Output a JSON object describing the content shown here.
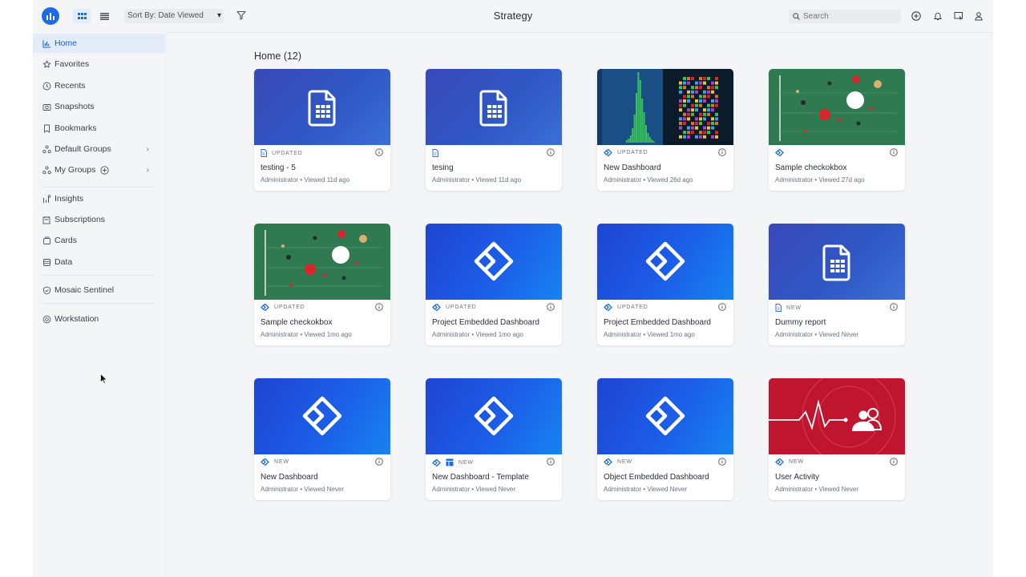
{
  "app": {
    "title": "Strategy"
  },
  "toolbar": {
    "sort_label": "Sort By: Date Viewed",
    "search_placeholder": "Search"
  },
  "sidebar": {
    "items": [
      {
        "label": "Home",
        "icon": "chart-icon",
        "active": true
      },
      {
        "label": "Favorites",
        "icon": "star-icon"
      },
      {
        "label": "Recents",
        "icon": "clock-icon"
      },
      {
        "label": "Snapshots",
        "icon": "camera-icon"
      },
      {
        "label": "Bookmarks",
        "icon": "bookmark-icon"
      },
      {
        "label": "Default Groups",
        "icon": "groups-icon"
      },
      {
        "label": "My Groups",
        "icon": "groups-icon"
      },
      {
        "label": "Insights",
        "icon": "insights-icon"
      },
      {
        "label": "Subscriptions",
        "icon": "subscriptions-icon"
      },
      {
        "label": "Cards",
        "icon": "cards-icon"
      },
      {
        "label": "Data",
        "icon": "database-icon"
      },
      {
        "label": "Mosaic Sentinel",
        "icon": "shield-icon"
      },
      {
        "label": "Workstation",
        "icon": "workstation-icon"
      }
    ]
  },
  "main": {
    "section_title": "Home (12)",
    "cards": [
      {
        "title": "testing - 5",
        "badge": "UPDATED",
        "sub": "Administrator • Viewed 11d ago",
        "type": "document",
        "thumb": "doc"
      },
      {
        "title": "tesing",
        "badge": "",
        "sub": "Administrator • Viewed 11d ago",
        "type": "document",
        "thumb": "doc"
      },
      {
        "title": "New Dashboard",
        "badge": "UPDATED",
        "sub": "Administrator • Viewed 26d ago",
        "type": "dashboard",
        "thumb": "chart"
      },
      {
        "title": "Sample checkokbox",
        "badge": "",
        "sub": "Administrator • Viewed 27d ago",
        "type": "dashboard",
        "thumb": "green"
      },
      {
        "title": "Sample checkokbox",
        "badge": "UPDATED",
        "sub": "Administrator • Viewed 1mo ago",
        "type": "dashboard",
        "thumb": "green"
      },
      {
        "title": "Project Embedded Dashboard",
        "badge": "UPDATED",
        "sub": "Administrator • Viewed 1mo ago",
        "type": "dashboard",
        "thumb": "dash"
      },
      {
        "title": "Project Embedded Dashboard",
        "badge": "UPDATED",
        "sub": "Administrator • Viewed 1mo ago",
        "type": "dashboard",
        "thumb": "dash"
      },
      {
        "title": "Dummy report",
        "badge": "NEW",
        "sub": "Administrator • Viewed Never",
        "type": "document",
        "thumb": "doc"
      },
      {
        "title": "New Dashboard",
        "badge": "NEW",
        "sub": "Administrator • Viewed Never",
        "type": "dashboard",
        "thumb": "dash"
      },
      {
        "title": "New Dashboard - Template",
        "badge": "NEW",
        "sub": "Administrator • Viewed Never",
        "type": "template",
        "thumb": "dash"
      },
      {
        "title": "Object Embedded Dashboard",
        "badge": "NEW",
        "sub": "Administrator • Viewed Never",
        "type": "dashboard",
        "thumb": "dash"
      },
      {
        "title": "User Activity",
        "badge": "NEW",
        "sub": "Administrator • Viewed Never",
        "type": "dashboard",
        "thumb": "red"
      }
    ]
  },
  "colors": {
    "accent": "#1b6ce3",
    "nav_active_bg": "#e4ecf9",
    "card_blue": "#1f4fd6",
    "card_green": "#2f7a50",
    "card_red": "#c0152e"
  }
}
